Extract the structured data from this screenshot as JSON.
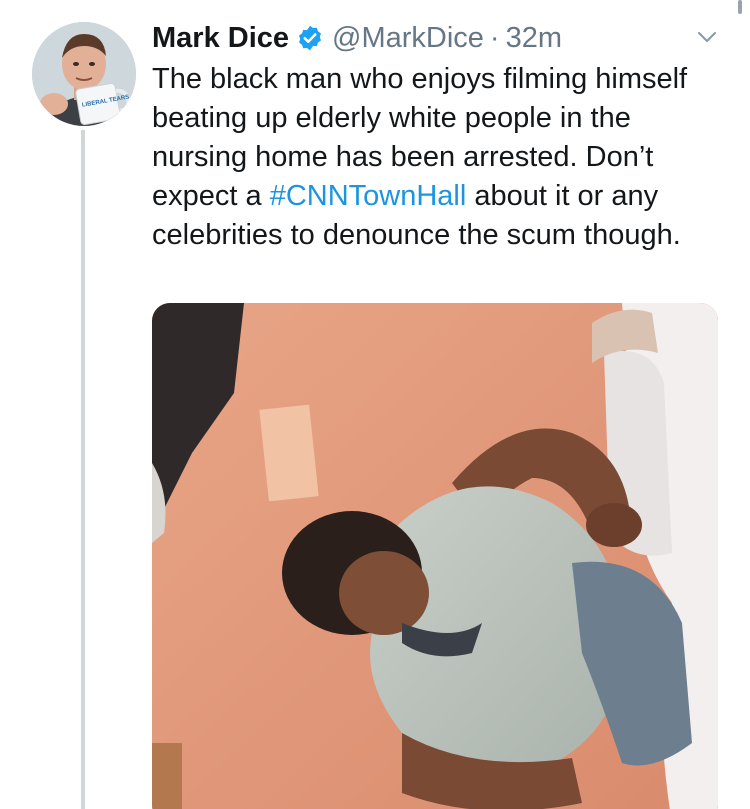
{
  "tweet": {
    "display_name": "Mark Dice",
    "handle": "@MarkDice",
    "separator": "·",
    "time": "32m",
    "text_before": "The black man who enjoys filming himself beating up elderly white people in the nursing home has been arrested. Don’t expect a ",
    "hashtag": "#CNNTownHall",
    "text_after": " about it or any celebrities to denounce the scum though.",
    "mug_text": "LIBERAL TEARS"
  },
  "colors": {
    "text": "#14171a",
    "secondary": "#657786",
    "link": "#1b95e0",
    "verified": "#1da1f2",
    "thread_line": "#cfd6dc"
  },
  "icons": {
    "verified": "verified-badge-icon",
    "menu": "chevron-down-icon"
  }
}
